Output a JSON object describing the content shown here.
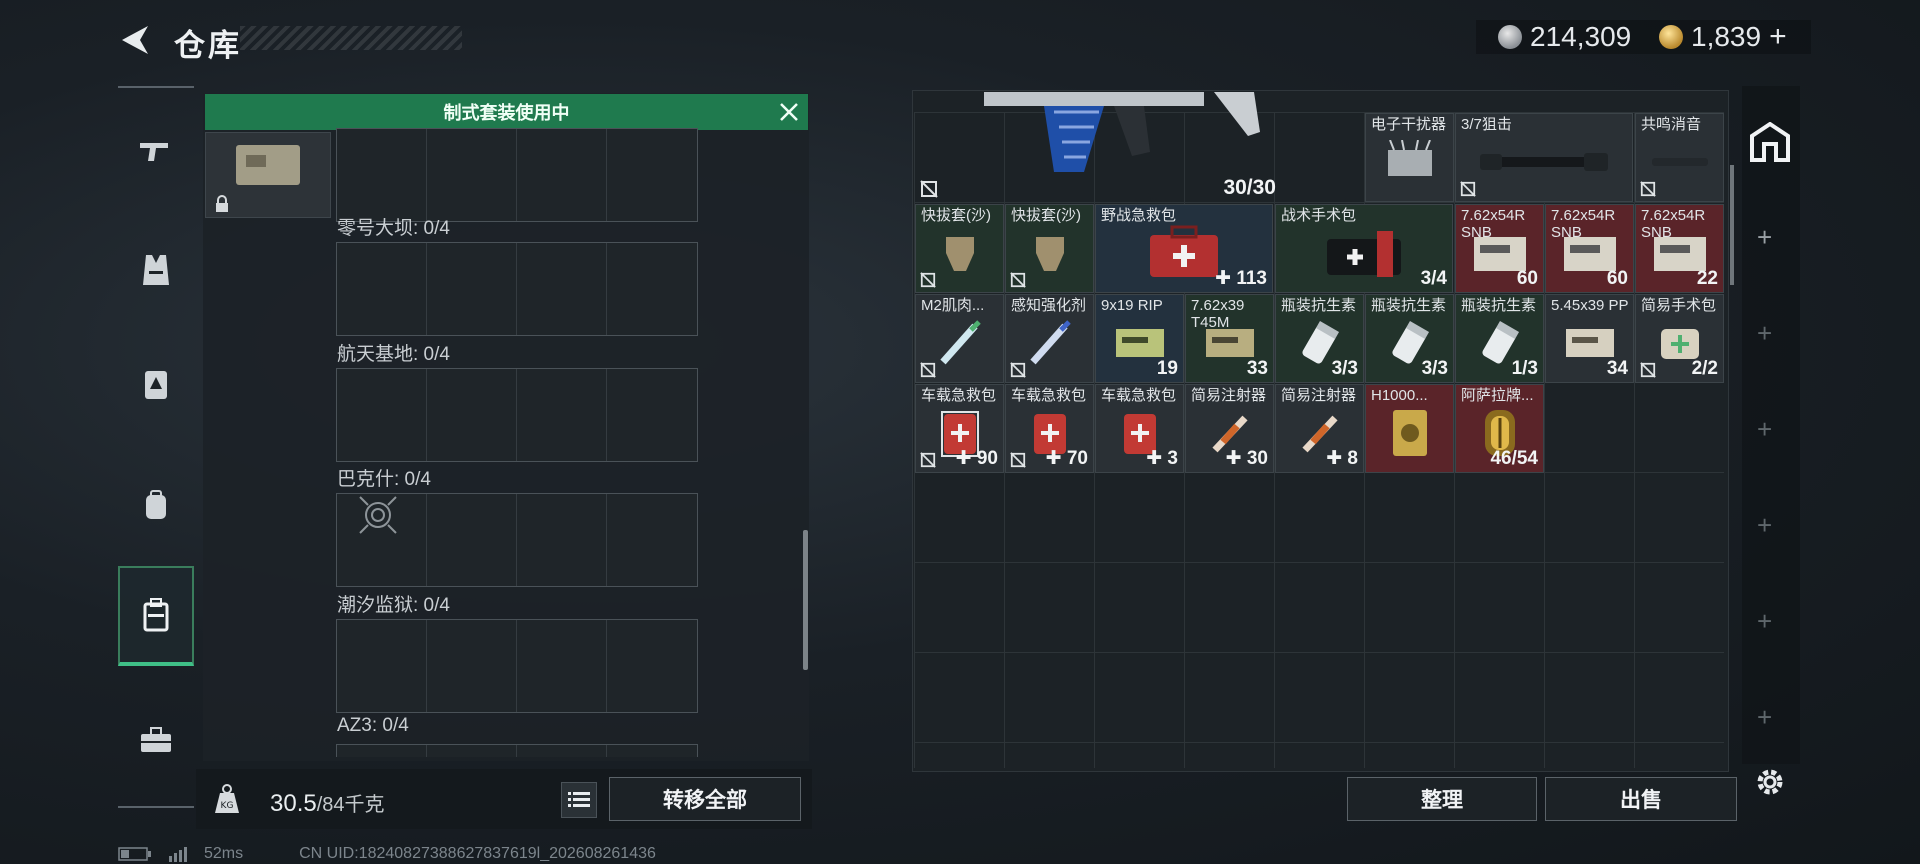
{
  "header": {
    "title": "仓库",
    "silver_amount": "214,309",
    "gold_amount": "1,839",
    "gold_add": "+"
  },
  "sidebar": {
    "items": [
      {
        "icon": "rifle-icon",
        "active": false
      },
      {
        "icon": "vest-icon",
        "active": false
      },
      {
        "icon": "chest-rig-icon",
        "active": false
      },
      {
        "icon": "backpack-icon",
        "active": false
      },
      {
        "icon": "storage-case-icon",
        "active": true
      },
      {
        "icon": "toolbox-icon",
        "active": false
      }
    ]
  },
  "left_panel": {
    "banner": "制式套装使用中",
    "maps": [
      {
        "label": "零号大坝: 0/4"
      },
      {
        "label": "航天基地: 0/4"
      },
      {
        "label": "巴克什: 0/4"
      },
      {
        "label": "潮汐监狱: 0/4"
      },
      {
        "label": "AZ3: 0/4"
      }
    ],
    "weight_value": "30.5",
    "weight_max": "/84千克",
    "transfer_all": "转移全部"
  },
  "status": {
    "ping": "52ms",
    "uid": "CN UID:18240827388627837619l_202608261436"
  },
  "stash": {
    "weapon_ammo": "30/30",
    "rows": [
      [
        {
          "name": "电子干扰器",
          "count": "",
          "bg": "gray"
        },
        {
          "name": "3/7狙击",
          "count": "",
          "bg": "gray"
        },
        {
          "name": "共鸣消音",
          "count": "",
          "bg": "gray"
        }
      ],
      [
        {
          "name": "快拔套(沙)",
          "count": "",
          "bg": "dgreen"
        },
        {
          "name": "快拔套(沙)",
          "count": "",
          "bg": "dgreen"
        },
        {
          "name": "野战急救包",
          "count": "113",
          "bg": "blue",
          "wide": true
        },
        {
          "name": "战术手术包",
          "count": "3/4",
          "bg": "dgreen",
          "wide": true
        },
        {
          "name": "7.62x54R SNB",
          "count": "60",
          "bg": "red"
        },
        {
          "name": "7.62x54R SNB",
          "count": "60",
          "bg": "red"
        },
        {
          "name": "7.62x54R SNB",
          "count": "22",
          "bg": "red"
        }
      ],
      [
        {
          "name": "M2肌肉...",
          "count": "",
          "bg": "gray"
        },
        {
          "name": "感知强化剂",
          "count": "",
          "bg": "gray"
        },
        {
          "name": "9x19 RIP",
          "count": "19",
          "bg": "blue"
        },
        {
          "name": "7.62x39 T45M",
          "count": "33",
          "bg": "dgreen"
        },
        {
          "name": "瓶装抗生素",
          "count": "3/3",
          "bg": "dgreen"
        },
        {
          "name": "瓶装抗生素",
          "count": "3/3",
          "bg": "dgreen"
        },
        {
          "name": "瓶装抗生素",
          "count": "1/3",
          "bg": "dgreen"
        },
        {
          "name": "5.45x39 PP",
          "count": "34",
          "bg": "gray"
        },
        {
          "name": "简易手术包",
          "count": "2/2",
          "bg": "gray"
        }
      ],
      [
        {
          "name": "车载急救包",
          "count": "90",
          "bg": "gray"
        },
        {
          "name": "车载急救包",
          "count": "70",
          "bg": "gray"
        },
        {
          "name": "车载急救包",
          "count": "3",
          "bg": "gray"
        },
        {
          "name": "简易注射器",
          "count": "30",
          "bg": "gray"
        },
        {
          "name": "简易注射器",
          "count": "8",
          "bg": "gray"
        },
        {
          "name": "H1000...",
          "count": "",
          "bg": "red"
        },
        {
          "name": "阿萨拉牌...",
          "count": "46/54",
          "bg": "red"
        }
      ]
    ],
    "organize": "整理",
    "sell": "出售"
  }
}
